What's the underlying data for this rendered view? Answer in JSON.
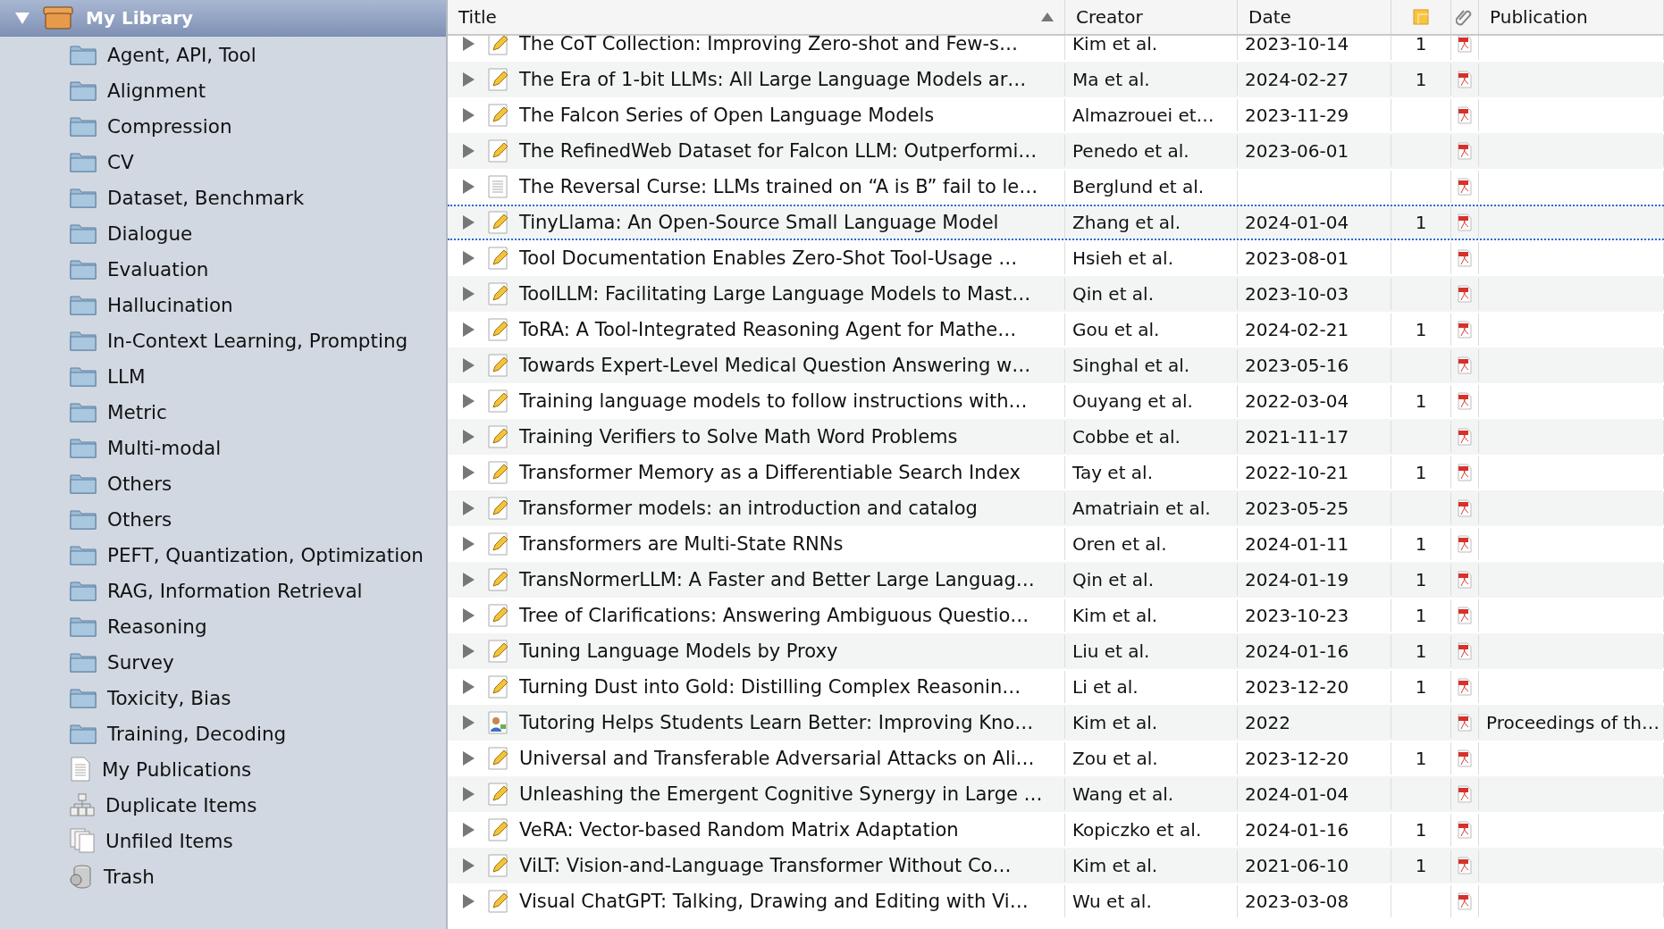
{
  "sidebar": {
    "library": {
      "label": "My Library",
      "expanded": true,
      "selected": true
    },
    "items": [
      {
        "label": "Agent, API, Tool",
        "kind": "folder",
        "selected": false
      },
      {
        "label": "Alignment",
        "kind": "folder",
        "selected": false
      },
      {
        "label": "Compression",
        "kind": "folder",
        "selected": false
      },
      {
        "label": "CV",
        "kind": "folder",
        "selected": false
      },
      {
        "label": "Dataset, Benchmark",
        "kind": "folder",
        "selected": false
      },
      {
        "label": "Dialogue",
        "kind": "folder",
        "selected": false
      },
      {
        "label": "Evaluation",
        "kind": "folder",
        "selected": false
      },
      {
        "label": "Hallucination",
        "kind": "folder",
        "selected": false
      },
      {
        "label": "In-Context Learning, Prompting",
        "kind": "folder",
        "selected": false
      },
      {
        "label": "LLM",
        "kind": "folder",
        "selected": false
      },
      {
        "label": "Metric",
        "kind": "folder",
        "selected": false
      },
      {
        "label": "Multi-modal",
        "kind": "folder",
        "selected": false
      },
      {
        "label": "Others",
        "kind": "folder",
        "selected": false
      },
      {
        "label": "Others",
        "kind": "folder",
        "selected": false
      },
      {
        "label": "PEFT, Quantization, Optimization",
        "kind": "folder",
        "selected": false
      },
      {
        "label": "RAG, Information Retrieval",
        "kind": "folder",
        "selected": false
      },
      {
        "label": "Reasoning",
        "kind": "folder",
        "selected": false
      },
      {
        "label": "Survey",
        "kind": "folder",
        "selected": false
      },
      {
        "label": "Toxicity, Bias",
        "kind": "folder",
        "selected": false
      },
      {
        "label": "Training, Decoding",
        "kind": "folder",
        "selected": false
      },
      {
        "label": "My Publications",
        "kind": "publications",
        "selected": false
      },
      {
        "label": "Duplicate Items",
        "kind": "duplicates",
        "selected": false
      },
      {
        "label": "Unfiled Items",
        "kind": "unfiled",
        "selected": false
      },
      {
        "label": "Trash",
        "kind": "trash",
        "selected": false
      }
    ]
  },
  "table": {
    "columns": [
      {
        "kind": "title",
        "label": "Title",
        "sorted_ascending": true
      },
      {
        "kind": "creator",
        "label": "Creator"
      },
      {
        "kind": "date",
        "label": "Date"
      },
      {
        "kind": "notes"
      },
      {
        "kind": "attachments"
      },
      {
        "kind": "publication",
        "label": "Publication"
      }
    ],
    "rows": [
      {
        "kind": "article",
        "title": "The CoT Collection: Improving Zero-shot and Few-s…",
        "creator": "Kim et al.",
        "date": "2023-10-14",
        "notes": "1",
        "has_pdf": true,
        "selected": false
      },
      {
        "kind": "article",
        "title": "The Era of 1-bit LLMs: All Large Language Models ar…",
        "creator": "Ma et al.",
        "date": "2024-02-27",
        "notes": "1",
        "has_pdf": true,
        "selected": false
      },
      {
        "kind": "article",
        "title": "The Falcon Series of Open Language Models",
        "creator": "Almazrouei et…",
        "date": "2023-11-29",
        "has_pdf": true,
        "selected": false
      },
      {
        "kind": "article",
        "title": "The RefinedWeb Dataset for Falcon LLM: Outperformi…",
        "creator": "Penedo et al.",
        "date": "2023-06-01",
        "has_pdf": true,
        "selected": false
      },
      {
        "kind": "document",
        "title": "The Reversal Curse: LLMs trained on “A is B” fail to le…",
        "creator": "Berglund et al.",
        "has_pdf": true,
        "selected": false
      },
      {
        "kind": "article",
        "title": "TinyLlama: An Open-Source Small Language Model",
        "creator": "Zhang et al.",
        "date": "2024-01-04",
        "notes": "1",
        "has_pdf": true,
        "selected": true
      },
      {
        "kind": "article",
        "title": "Tool Documentation Enables Zero-Shot Tool-Usage …",
        "creator": "Hsieh et al.",
        "date": "2023-08-01",
        "has_pdf": true,
        "selected": false
      },
      {
        "kind": "article",
        "title": "ToolLLM: Facilitating Large Language Models to Mast…",
        "creator": "Qin et al.",
        "date": "2023-10-03",
        "has_pdf": true,
        "selected": false
      },
      {
        "kind": "article",
        "title": "ToRA: A Tool-Integrated Reasoning Agent for Mathe…",
        "creator": "Gou et al.",
        "date": "2024-02-21",
        "notes": "1",
        "has_pdf": true,
        "selected": false
      },
      {
        "kind": "article",
        "title": "Towards Expert-Level Medical Question Answering w…",
        "creator": "Singhal et al.",
        "date": "2023-05-16",
        "has_pdf": true,
        "selected": false
      },
      {
        "kind": "article",
        "title": "Training language models to follow instructions with…",
        "creator": "Ouyang et al.",
        "date": "2022-03-04",
        "notes": "1",
        "has_pdf": true,
        "selected": false
      },
      {
        "kind": "article",
        "title": "Training Verifiers to Solve Math Word Problems",
        "creator": "Cobbe et al.",
        "date": "2021-11-17",
        "has_pdf": true,
        "selected": false
      },
      {
        "kind": "article",
        "title": "Transformer Memory as a Differentiable Search Index",
        "creator": "Tay et al.",
        "date": "2022-10-21",
        "notes": "1",
        "has_pdf": true,
        "selected": false
      },
      {
        "kind": "article",
        "title": "Transformer models: an introduction and catalog",
        "creator": "Amatriain et al.",
        "date": "2023-05-25",
        "has_pdf": true,
        "selected": false
      },
      {
        "kind": "article",
        "title": "Transformers are Multi-State RNNs",
        "creator": "Oren et al.",
        "date": "2024-01-11",
        "notes": "1",
        "has_pdf": true,
        "selected": false
      },
      {
        "kind": "article",
        "title": "TransNormerLLM: A Faster and Better Large Languag…",
        "creator": "Qin et al.",
        "date": "2024-01-19",
        "notes": "1",
        "has_pdf": true,
        "selected": false
      },
      {
        "kind": "article",
        "title": "Tree of Clarifications: Answering Ambiguous Questio…",
        "creator": "Kim et al.",
        "date": "2023-10-23",
        "notes": "1",
        "has_pdf": true,
        "selected": false
      },
      {
        "kind": "article",
        "title": "Tuning Language Models by Proxy",
        "creator": "Liu et al.",
        "date": "2024-01-16",
        "notes": "1",
        "has_pdf": true,
        "selected": false
      },
      {
        "kind": "article",
        "title": "Turning Dust into Gold: Distilling Complex Reasonin…",
        "creator": "Li et al.",
        "date": "2023-12-20",
        "notes": "1",
        "has_pdf": true,
        "selected": false
      },
      {
        "kind": "conference",
        "title": "Tutoring Helps Students Learn Better: Improving Kno…",
        "creator": "Kim et al.",
        "date": "2022",
        "has_pdf": true,
        "publication": "Proceedings of th…",
        "selected": false
      },
      {
        "kind": "article",
        "title": "Universal and Transferable Adversarial Attacks on Ali…",
        "creator": "Zou et al.",
        "date": "2023-12-20",
        "notes": "1",
        "has_pdf": true,
        "selected": false
      },
      {
        "kind": "article",
        "title": "Unleashing the Emergent Cognitive Synergy in Large …",
        "creator": "Wang et al.",
        "date": "2024-01-04",
        "has_pdf": true,
        "selected": false
      },
      {
        "kind": "article",
        "title": "VeRA: Vector-based Random Matrix Adaptation",
        "creator": "Kopiczko et al.",
        "date": "2024-01-16",
        "notes": "1",
        "has_pdf": true,
        "selected": false
      },
      {
        "kind": "article",
        "title": "ViLT: Vision-and-Language Transformer Without Co…",
        "creator": "Kim et al.",
        "date": "2021-06-10",
        "notes": "1",
        "has_pdf": true,
        "selected": false
      },
      {
        "kind": "article",
        "title": "Visual ChatGPT: Talking, Drawing and Editing with Vi…",
        "creator": "Wu et al.",
        "date": "2023-03-08",
        "has_pdf": true,
        "selected": false
      }
    ]
  }
}
